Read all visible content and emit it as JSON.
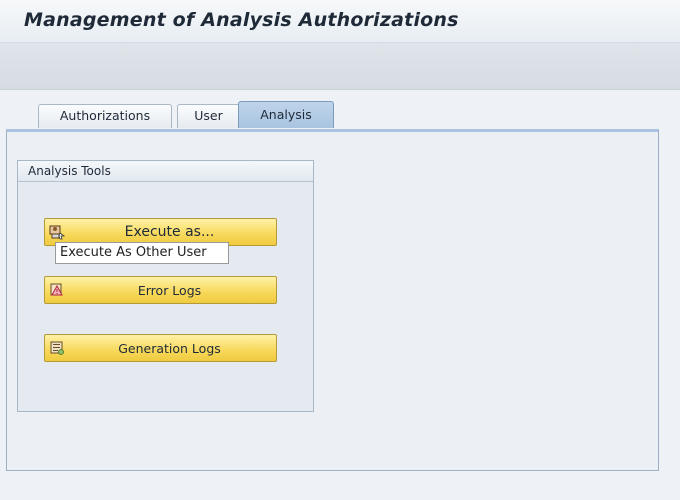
{
  "window": {
    "title": "Management of Analysis Authorizations"
  },
  "tabs": [
    {
      "label": "Authorizations",
      "active": false
    },
    {
      "label": "User",
      "active": false
    },
    {
      "label": "Analysis",
      "active": true
    }
  ],
  "analysis_tools": {
    "group_title": "Analysis Tools",
    "buttons": [
      {
        "label": "Execute as...",
        "icon": "execute-user-icon"
      },
      {
        "label": "Error Logs",
        "icon": "error-logs-icon"
      },
      {
        "label": "Generation Logs",
        "icon": "generation-logs-icon"
      }
    ],
    "tooltip": "Execute As Other User"
  },
  "colors": {
    "button_bg": "#f7d85a",
    "tab_active": "#a9c4e1",
    "title_text": "#1f2a38"
  }
}
